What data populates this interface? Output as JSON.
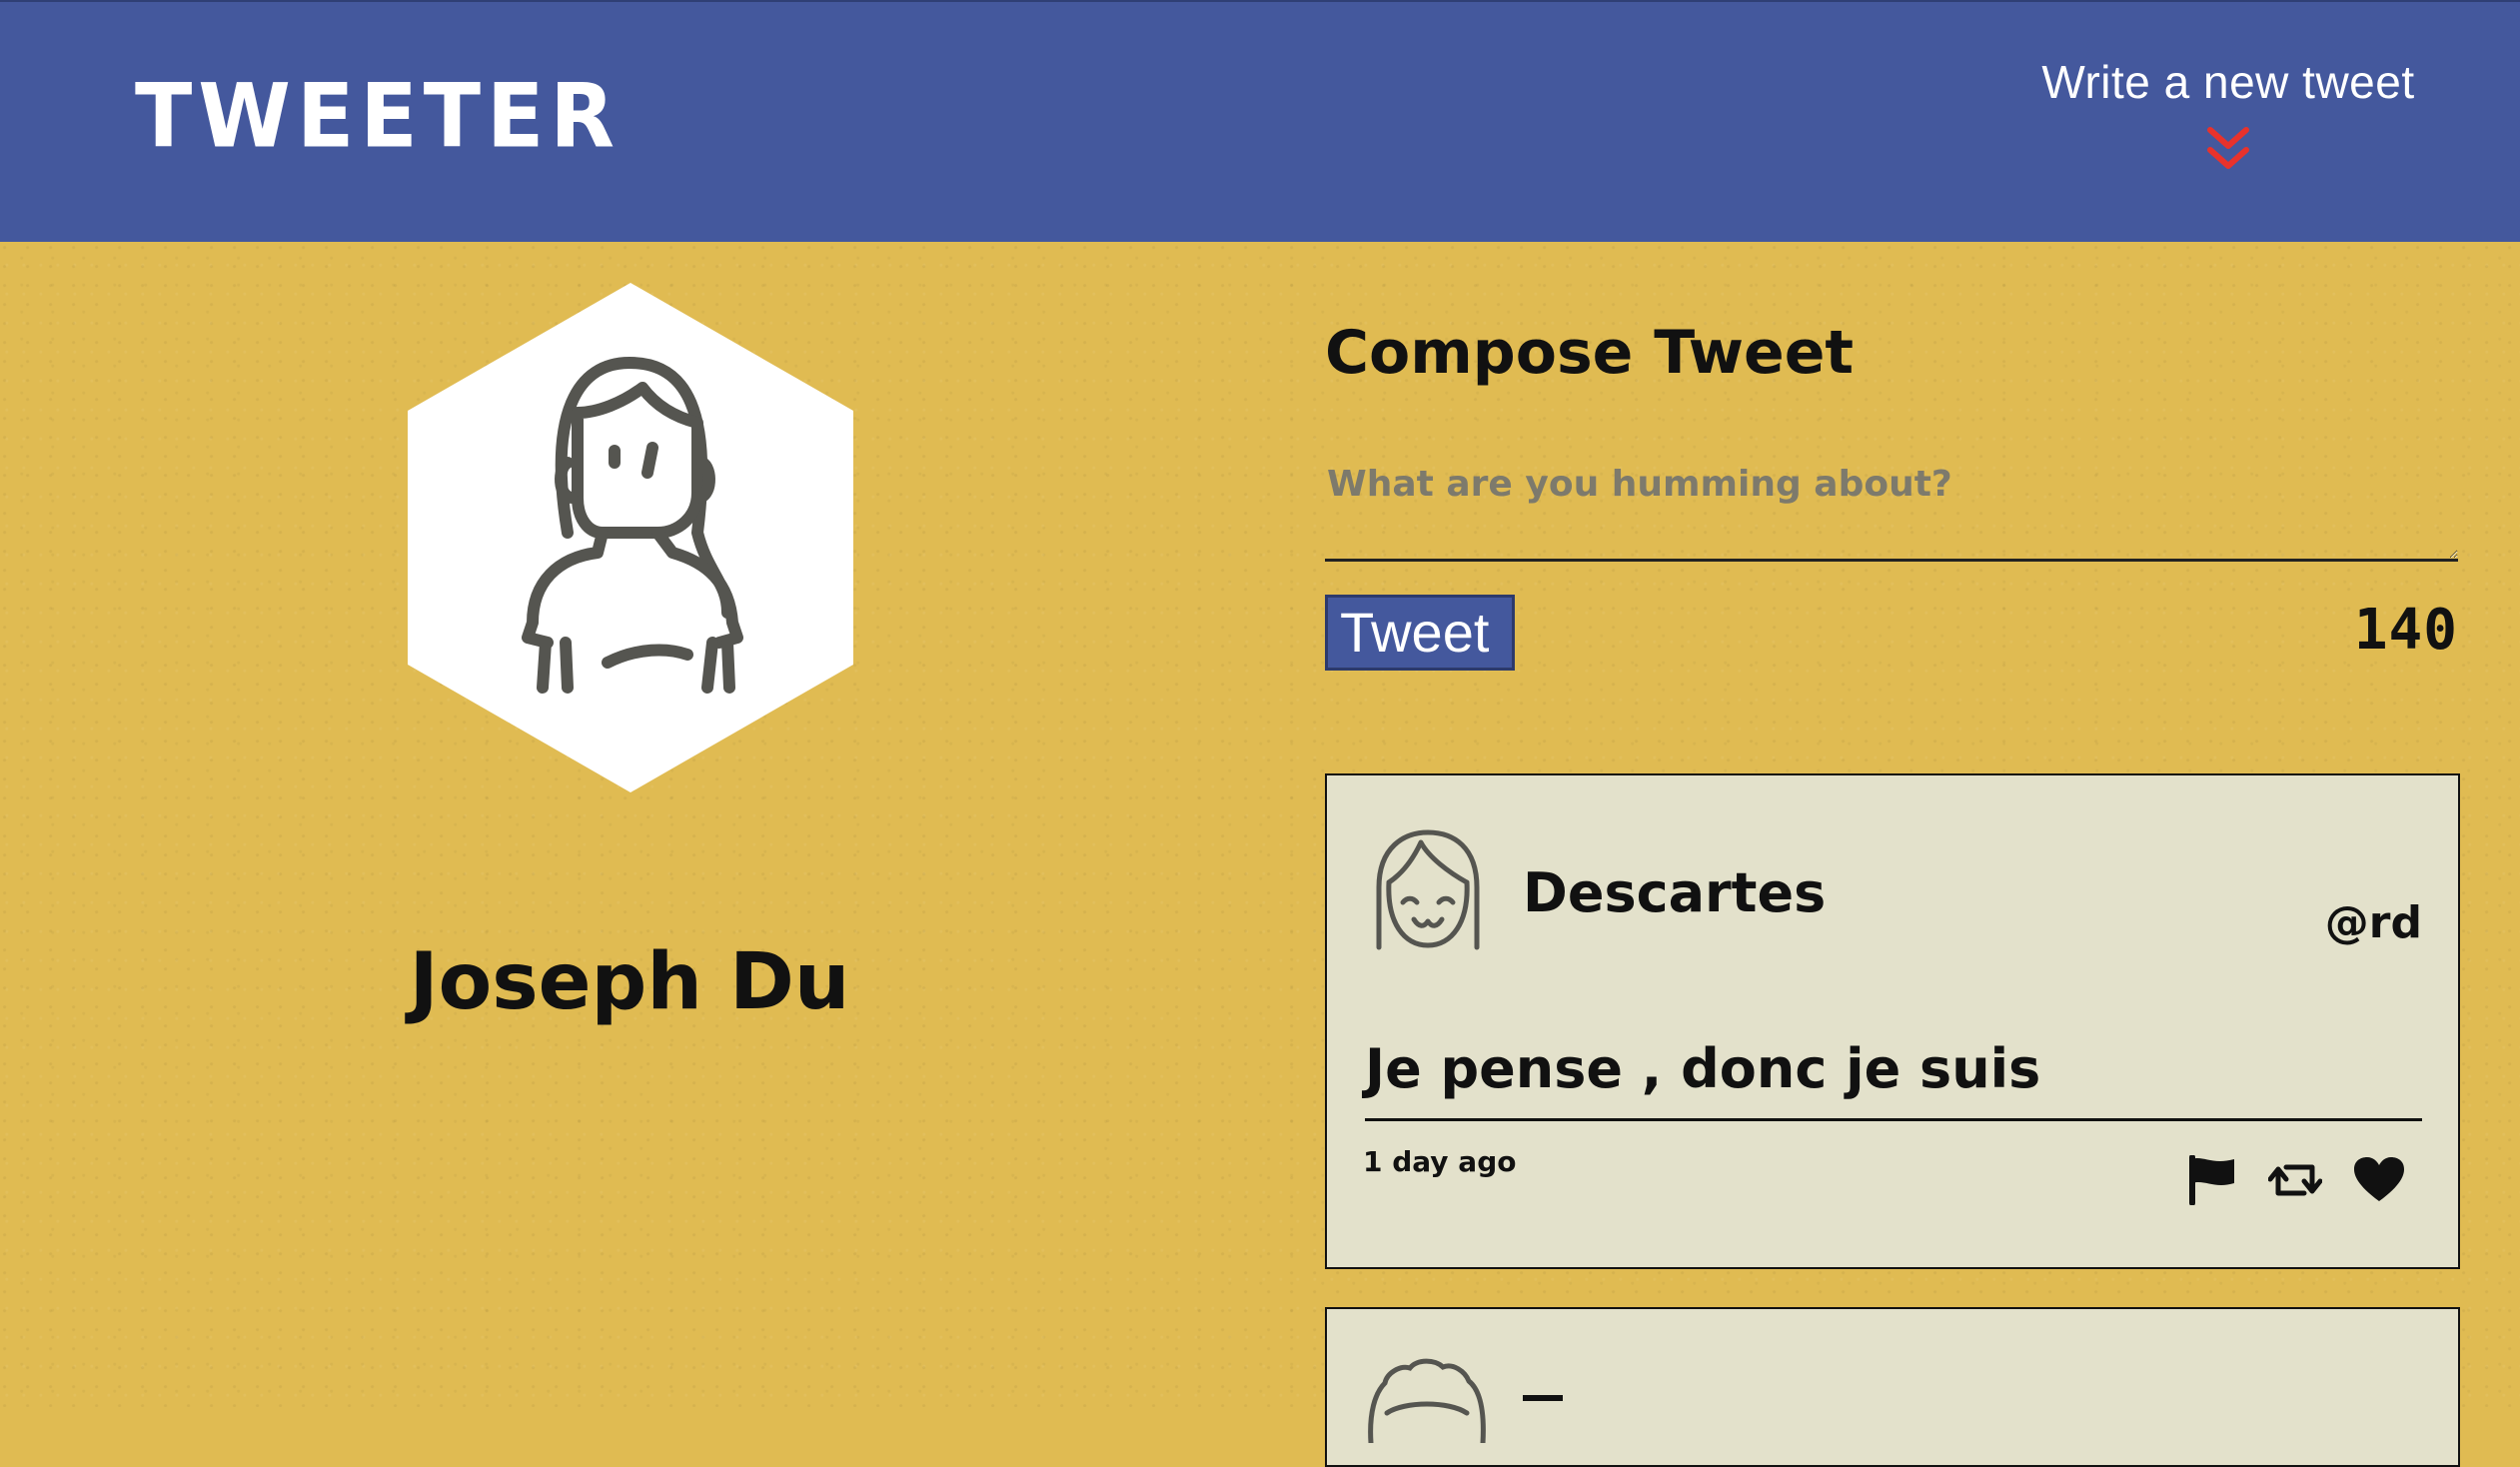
{
  "header": {
    "brand": "TWEETER",
    "compose_toggle_label": "Write a new tweet",
    "chevron_color": "#e8322c",
    "bg_color": "#44589d"
  },
  "profile": {
    "name": "Joseph Du",
    "avatar_icon": "woman-avatar-icon"
  },
  "compose": {
    "title": "Compose Tweet",
    "placeholder": "What are you humming about?",
    "value": "",
    "button_label": "Tweet",
    "char_count": "140"
  },
  "tweets": [
    {
      "author": "Descartes",
      "handle": "@rd",
      "body": "Je pense , donc je suis",
      "time": "1 day ago",
      "avatar_icon": "smiling-girl-avatar-icon",
      "actions": [
        "flag-icon",
        "retweet-icon",
        "heart-icon"
      ]
    }
  ],
  "colors": {
    "page_bg": "#e0bb52",
    "card_bg": "#e3e1cb",
    "accent": "#44589d"
  }
}
